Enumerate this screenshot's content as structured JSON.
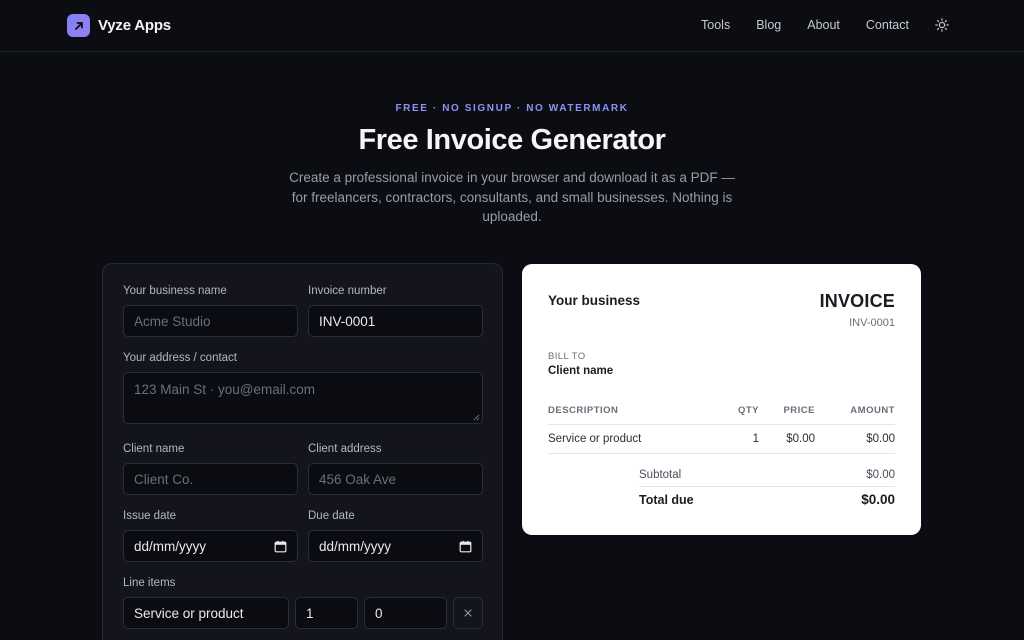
{
  "header": {
    "brand": "Vyze Apps",
    "nav": [
      "Tools",
      "Blog",
      "About",
      "Contact"
    ],
    "theme_icon": "sun-icon"
  },
  "hero": {
    "eyebrow": "FREE · NO SIGNUP · NO WATERMARK",
    "title": "Free Invoice Generator",
    "subtitle": "Create a professional invoice in your browser and download it as a PDF — for freelancers, contractors, consultants, and small businesses. Nothing is uploaded."
  },
  "form": {
    "business_name": {
      "label": "Your business name",
      "placeholder": "Acme Studio",
      "value": ""
    },
    "invoice_number": {
      "label": "Invoice number",
      "value": "INV-0001"
    },
    "address": {
      "label": "Your address / contact",
      "placeholder": "123 Main St · you@email.com",
      "value": ""
    },
    "client_name": {
      "label": "Client name",
      "placeholder": "Client Co.",
      "value": ""
    },
    "client_address": {
      "label": "Client address",
      "placeholder": "456 Oak Ave",
      "value": ""
    },
    "issue_date": {
      "label": "Issue date",
      "value": "dd/mm/yyyy"
    },
    "due_date": {
      "label": "Due date",
      "value": "dd/mm/yyyy"
    },
    "line_items": {
      "label": "Line items",
      "rows": [
        {
          "description": "Service or product",
          "qty": "1",
          "price": "0"
        }
      ]
    }
  },
  "preview": {
    "business": "Your business",
    "heading": "INVOICE",
    "invoice_number": "INV-0001",
    "bill_to_label": "BILL TO",
    "client": "Client name",
    "columns": [
      "DESCRIPTION",
      "QTY",
      "PRICE",
      "AMOUNT"
    ],
    "rows": [
      {
        "description": "Service or product",
        "qty": "1",
        "price": "$0.00",
        "amount": "$0.00"
      }
    ],
    "subtotal_label": "Subtotal",
    "subtotal": "$0.00",
    "total_label": "Total due",
    "total": "$0.00"
  },
  "colors": {
    "background": "#0c0d12",
    "accent": "#8b93f5",
    "card": "#14151c",
    "field": "#0b0c11"
  }
}
